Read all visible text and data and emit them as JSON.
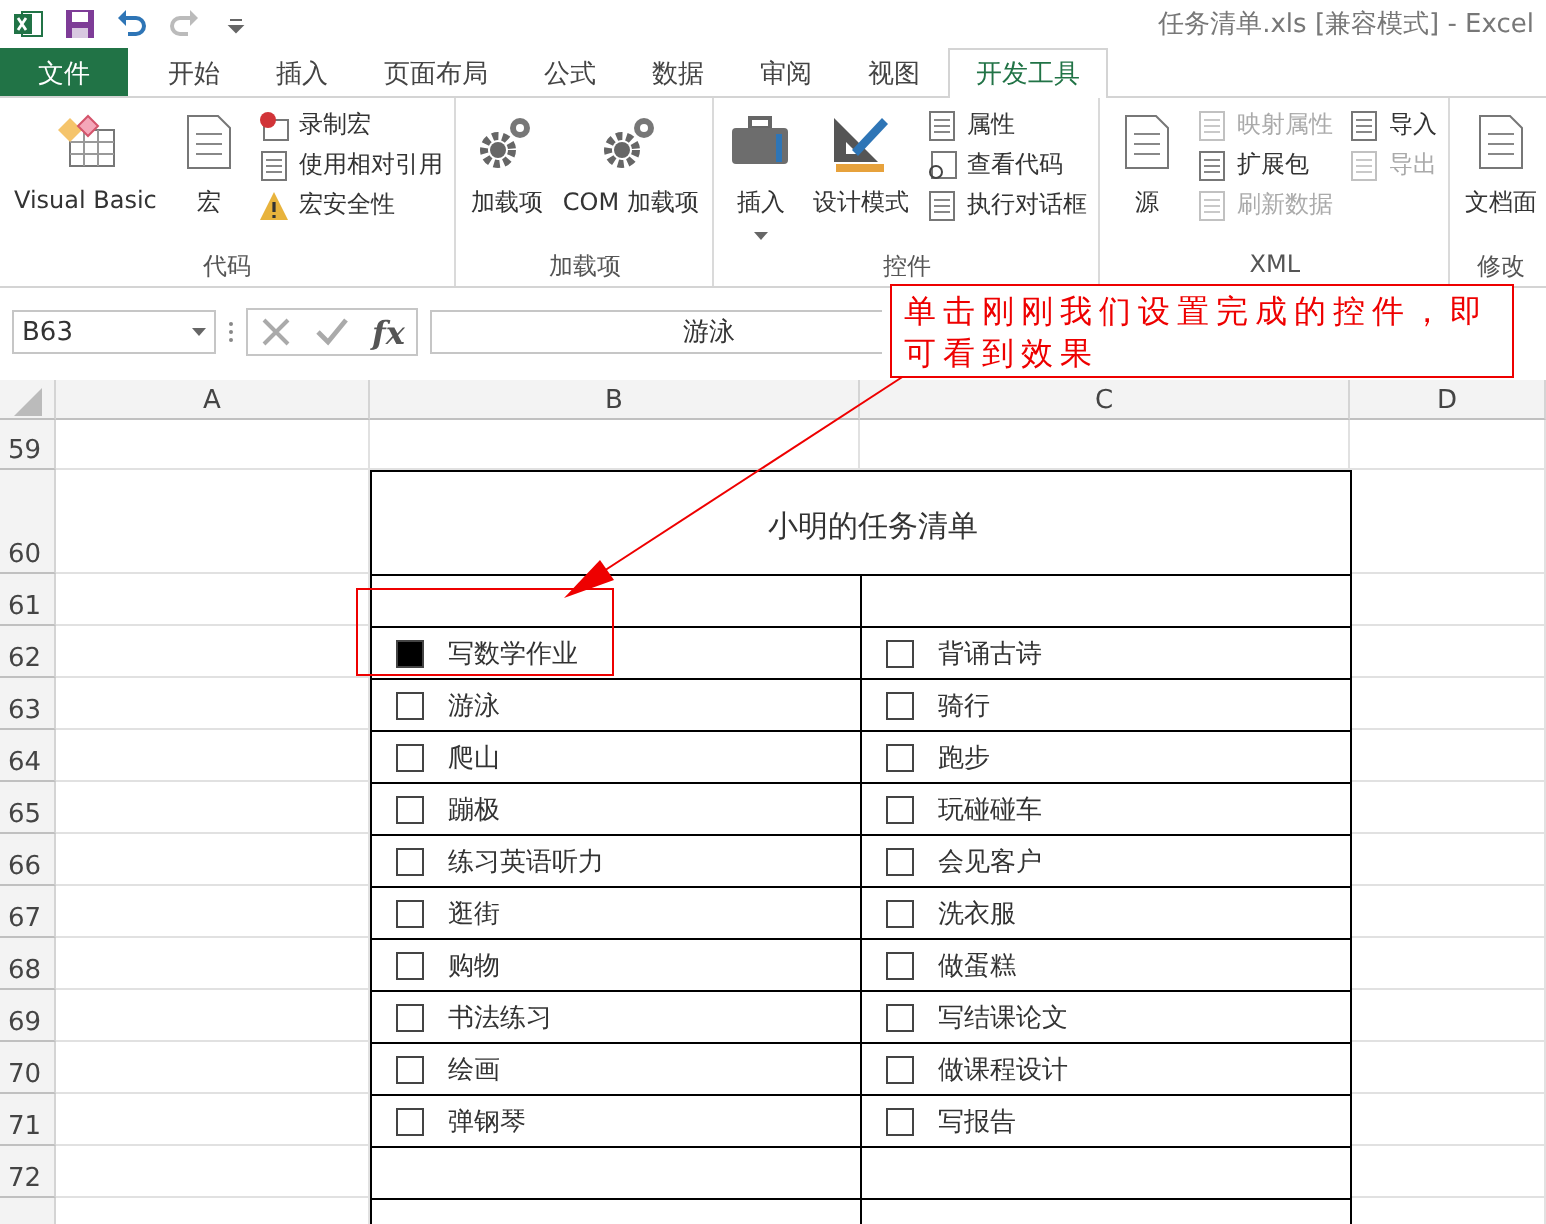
{
  "title_bar": {
    "title": "任务清单.xls  [兼容模式] - Excel"
  },
  "tabs": [
    {
      "label": "文件",
      "kind": "file",
      "selected": false
    },
    {
      "label": "开始",
      "kind": "tab",
      "selected": false
    },
    {
      "label": "插入",
      "kind": "tab",
      "selected": false
    },
    {
      "label": "页面布局",
      "kind": "tab",
      "selected": false
    },
    {
      "label": "公式",
      "kind": "tab",
      "selected": false
    },
    {
      "label": "数据",
      "kind": "tab",
      "selected": false
    },
    {
      "label": "审阅",
      "kind": "tab",
      "selected": false
    },
    {
      "label": "视图",
      "kind": "tab",
      "selected": false
    },
    {
      "label": "开发工具",
      "kind": "tab",
      "selected": true
    }
  ],
  "ribbon_groups": [
    {
      "label": "代码",
      "items": [
        {
          "kind": "large",
          "label": "Visual Basic"
        },
        {
          "kind": "large",
          "label": "宏"
        },
        {
          "kind": "stack",
          "items": [
            {
              "label": "录制宏",
              "disabled": false
            },
            {
              "label": "使用相对引用",
              "disabled": false
            },
            {
              "label": "宏安全性",
              "disabled": false
            }
          ]
        }
      ]
    },
    {
      "label": "加载项",
      "items": [
        {
          "kind": "large",
          "label": "加载项"
        },
        {
          "kind": "large",
          "label": "COM 加载项"
        }
      ]
    },
    {
      "label": "控件",
      "items": [
        {
          "kind": "dropdown",
          "label": "插入"
        },
        {
          "kind": "large",
          "label": "设计模式"
        },
        {
          "kind": "stack",
          "items": [
            {
              "label": "属性",
              "disabled": false
            },
            {
              "label": "查看代码",
              "disabled": false
            },
            {
              "label": "执行对话框",
              "disabled": false
            }
          ]
        }
      ]
    },
    {
      "label": "XML",
      "items": [
        {
          "kind": "large",
          "label": "源"
        },
        {
          "kind": "stack",
          "items": [
            {
              "label": "映射属性",
              "disabled": true
            },
            {
              "label": "扩展包",
              "disabled": false
            },
            {
              "label": "刷新数据",
              "disabled": true
            }
          ]
        },
        {
          "kind": "stack",
          "items": [
            {
              "label": "导入",
              "disabled": false
            },
            {
              "label": "导出",
              "disabled": true
            }
          ]
        }
      ]
    },
    {
      "label": "修改",
      "items": [
        {
          "kind": "large",
          "label": "文档面"
        }
      ]
    }
  ],
  "formula_bar": {
    "name_box": "B63",
    "function_button": "fx",
    "formula": "游泳"
  },
  "columns": [
    "A",
    "B",
    "C",
    "D"
  ],
  "row_numbers": [
    "59",
    "60",
    "61",
    "62",
    "63",
    "64",
    "65",
    "66",
    "67",
    "68",
    "69",
    "70",
    "71",
    "72"
  ],
  "sheet_title": "小明的任务清单",
  "tasks": [
    {
      "left": {
        "label": "写数学作业",
        "checked": true
      },
      "right": {
        "label": "背诵古诗",
        "checked": false
      }
    },
    {
      "left": {
        "label": "游泳",
        "checked": false
      },
      "right": {
        "label": "骑行",
        "checked": false
      }
    },
    {
      "left": {
        "label": "爬山",
        "checked": false
      },
      "right": {
        "label": "跑步",
        "checked": false
      }
    },
    {
      "left": {
        "label": "蹦极",
        "checked": false
      },
      "right": {
        "label": "玩碰碰车",
        "checked": false
      }
    },
    {
      "left": {
        "label": "练习英语听力",
        "checked": false
      },
      "right": {
        "label": "会见客户",
        "checked": false
      }
    },
    {
      "left": {
        "label": "逛街",
        "checked": false
      },
      "right": {
        "label": "洗衣服",
        "checked": false
      }
    },
    {
      "left": {
        "label": "购物",
        "checked": false
      },
      "right": {
        "label": "做蛋糕",
        "checked": false
      }
    },
    {
      "left": {
        "label": "书法练习",
        "checked": false
      },
      "right": {
        "label": "写结课论文",
        "checked": false
      }
    },
    {
      "left": {
        "label": "绘画",
        "checked": false
      },
      "right": {
        "label": "做课程设计",
        "checked": false
      }
    },
    {
      "left": {
        "label": "弹钢琴",
        "checked": false
      },
      "right": {
        "label": "写报告",
        "checked": false
      }
    }
  ],
  "callout": {
    "text": "单击刚刚我们设置完成的控件，即可看到效果"
  }
}
